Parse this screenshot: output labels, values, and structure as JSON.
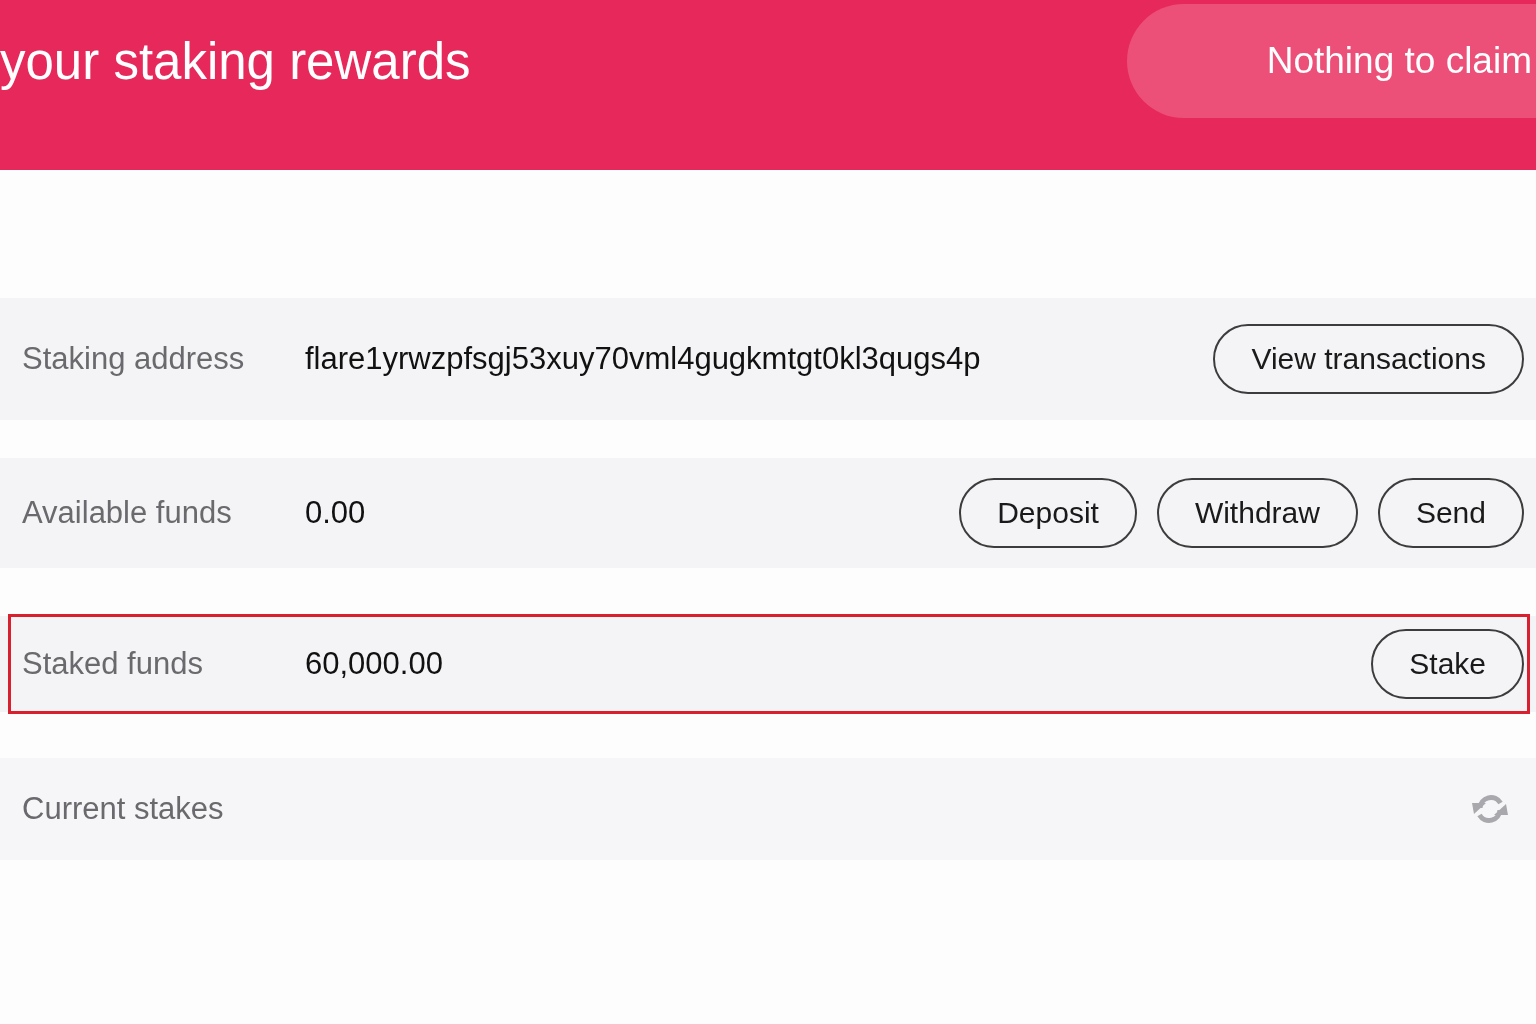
{
  "header": {
    "title": "your staking rewards",
    "claim_button": {
      "label": "Nothing to claim",
      "disabled": true
    }
  },
  "rows": [
    {
      "kind": "field",
      "label": "Staking address",
      "value": "flare1yrwzpfsgj53xuy70vml4gugkmtgt0kl3qugs4p",
      "highlighted": false,
      "buttons": [
        "View transactions"
      ]
    },
    {
      "kind": "field",
      "label": "Available funds",
      "value": "0.00",
      "highlighted": false,
      "buttons": [
        "Deposit",
        "Withdraw",
        "Send"
      ]
    },
    {
      "kind": "field",
      "label": "Staked funds",
      "value": "60,000.00",
      "highlighted": true,
      "buttons": [
        "Stake"
      ]
    },
    {
      "kind": "section",
      "label": "Current stakes",
      "highlighted": false
    }
  ]
}
